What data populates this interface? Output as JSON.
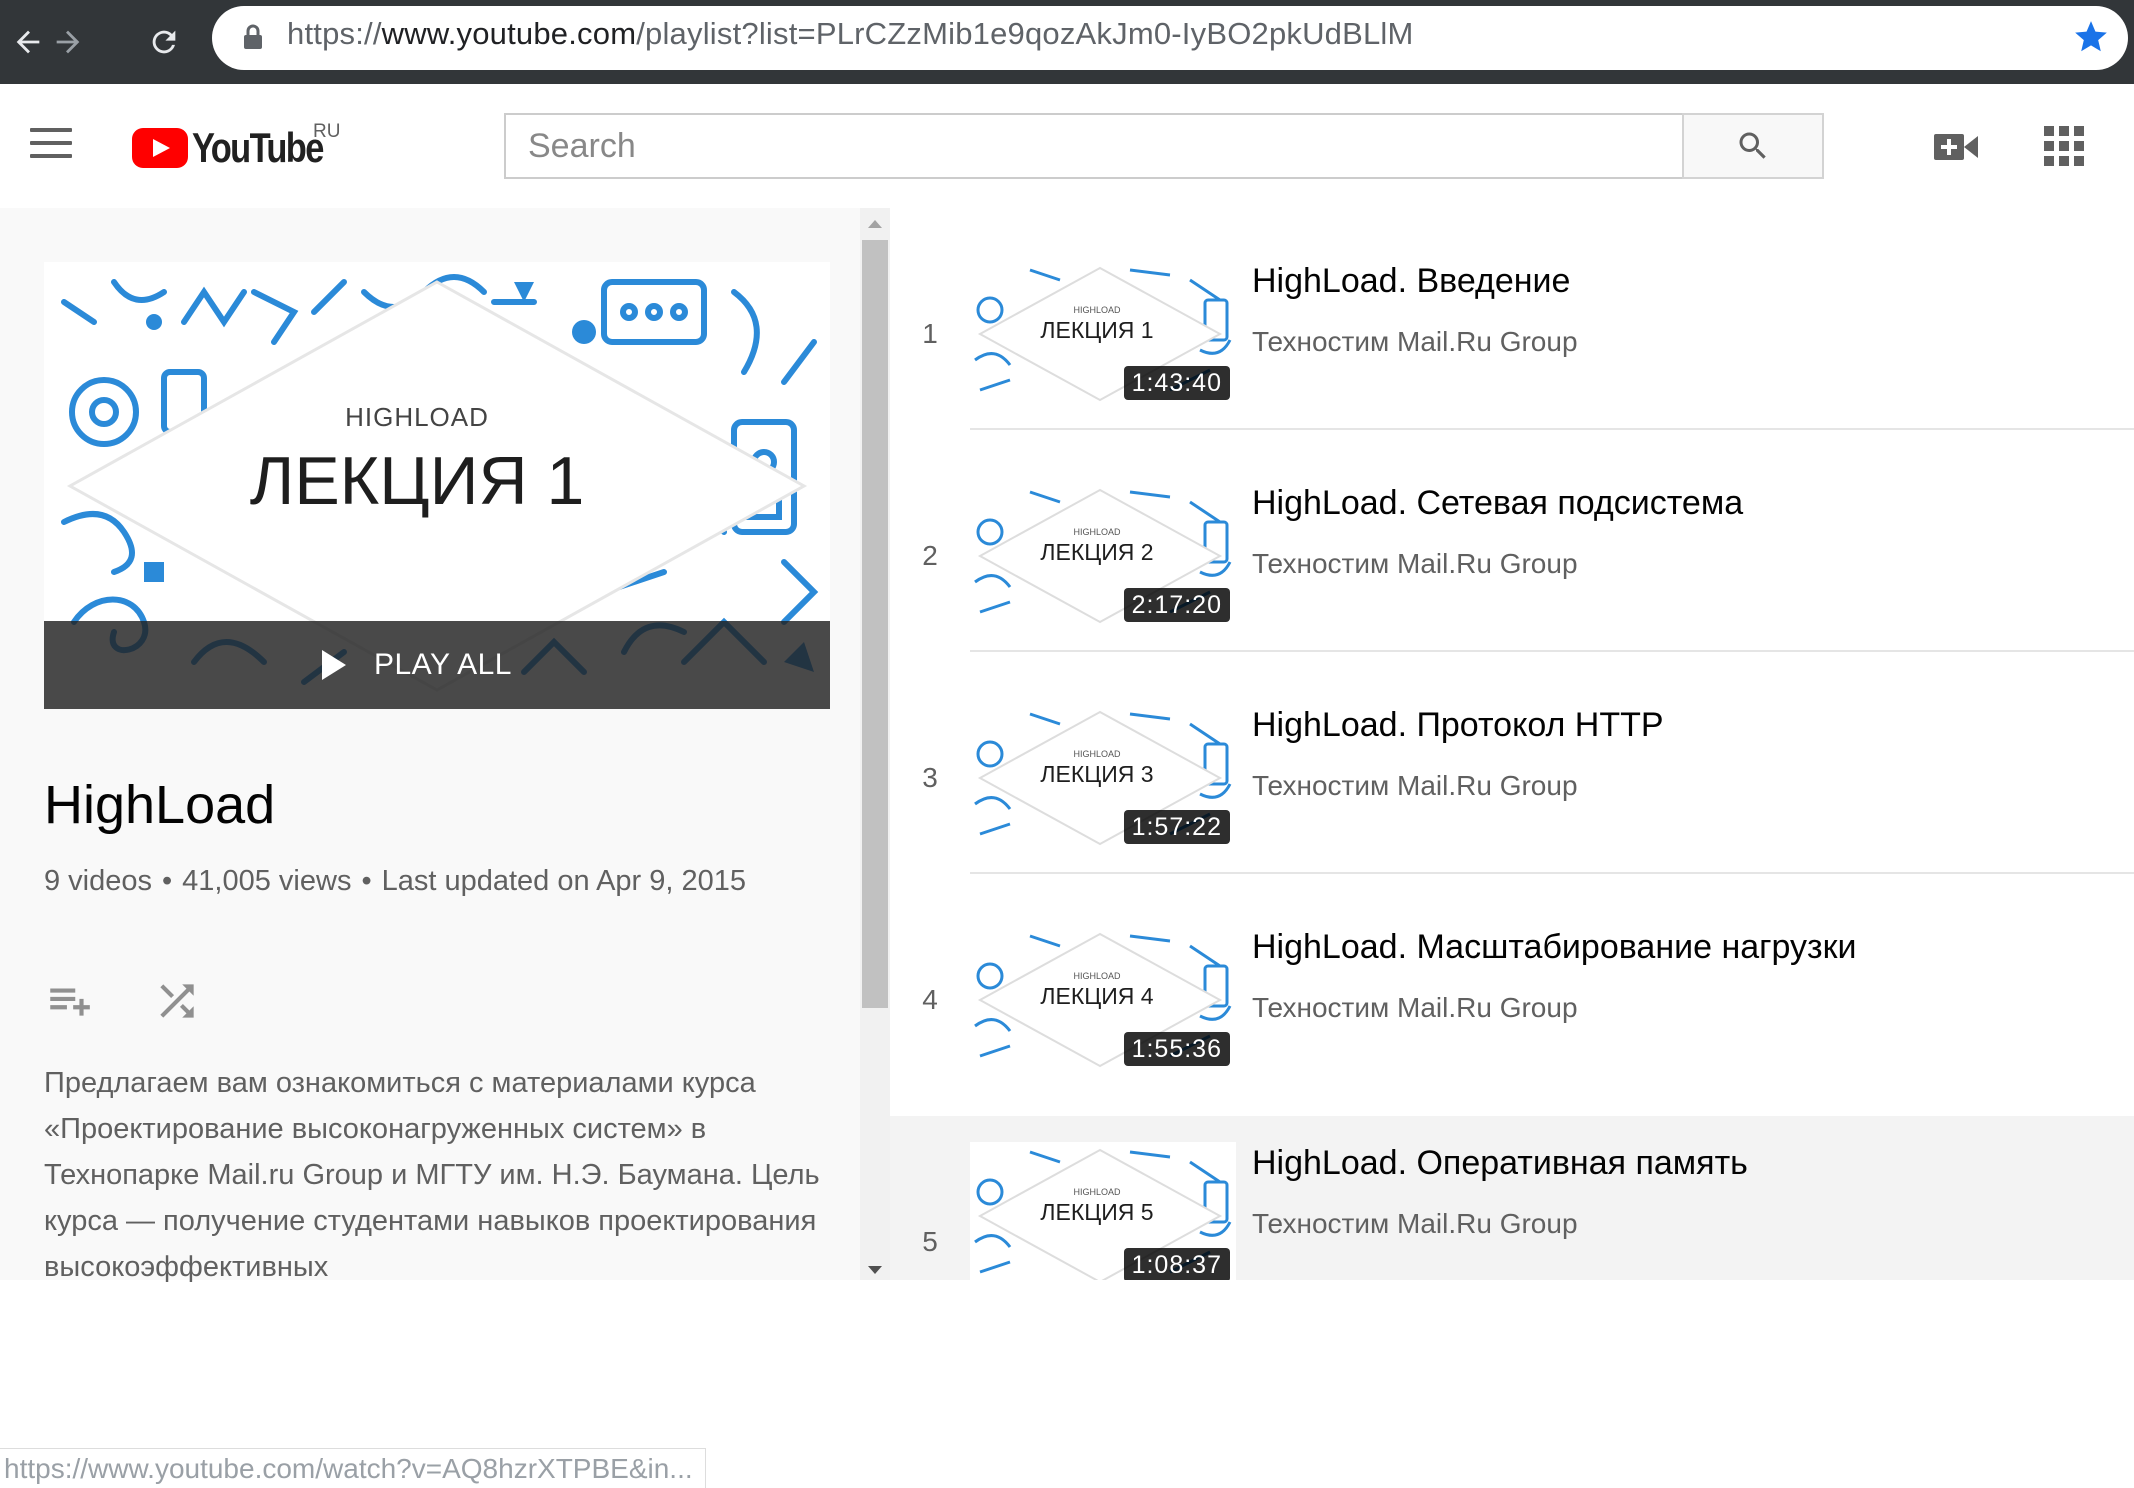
{
  "browser": {
    "url_scheme": "https://",
    "url_host": "www.youtube.com",
    "url_path": "/playlist?list=PLrCZzMib1e9qozAkJm0-IyBO2pkUdBLlM",
    "status_url": "https://www.youtube.com/watch?v=AQ8hzrXTPBE&in..."
  },
  "header": {
    "logo_text": "YouTube",
    "region": "RU",
    "search_placeholder": "Search"
  },
  "playlist": {
    "hero_small": "HIGHLOAD",
    "hero_big": "ЛЕКЦИЯ 1",
    "play_all_label": "PLAY ALL",
    "title": "HighLoad",
    "videos": "9 videos",
    "views": "41,005 views",
    "updated": "Last updated on Apr 9, 2015",
    "separator": "•",
    "description": "Предлагаем вам ознакомиться с материалами курса «Проектирование высоконагруженных систем» в Технопарке Mail.ru Group и МГТУ им. Н.Э. Баумана. Цель курса — получение студентами навыков проектирования высокоэффективных"
  },
  "videos": [
    {
      "index": "1",
      "title": "HighLoad. Введение",
      "channel": "Техностим Mail.Ru Group",
      "duration": "1:43:40",
      "thumb_small": "HIGHLOAD",
      "thumb_big": "ЛЕКЦИЯ 1"
    },
    {
      "index": "2",
      "title": "HighLoad. Сетевая подсистема",
      "channel": "Техностим Mail.Ru Group",
      "duration": "2:17:20",
      "thumb_small": "HIGHLOAD",
      "thumb_big": "ЛЕКЦИЯ 2"
    },
    {
      "index": "3",
      "title": "HighLoad. Протокол HTTP",
      "channel": "Техностим Mail.Ru Group",
      "duration": "1:57:22",
      "thumb_small": "HIGHLOAD",
      "thumb_big": "ЛЕКЦИЯ 3"
    },
    {
      "index": "4",
      "title": "HighLoad. Масштабирование нагрузки",
      "channel": "Техностим Mail.Ru Group",
      "duration": "1:55:36",
      "thumb_small": "HIGHLOAD",
      "thumb_big": "ЛЕКЦИЯ 4"
    },
    {
      "index": "5",
      "title": "HighLoad. Оперативная память",
      "channel": "Техностим Mail.Ru Group",
      "duration": "1:08:37",
      "thumb_small": "HIGHLOAD",
      "thumb_big": "ЛЕКЦИЯ 5"
    }
  ],
  "icons": {
    "back": "arrow-left-icon",
    "forward": "arrow-right-icon",
    "reload": "reload-icon",
    "lock": "lock-icon",
    "bookmark": "star-icon",
    "menu": "hamburger-icon",
    "search": "search-icon",
    "create": "video-camera-plus-icon",
    "apps": "apps-grid-icon",
    "add_to_queue": "playlist-add-icon",
    "shuffle": "shuffle-icon",
    "play": "play-icon"
  },
  "colors": {
    "brand_red": "#ff0000",
    "browser_bar": "#323639",
    "bookmark_star": "#1a73e8",
    "doodle_blue": "#2b8ad8"
  }
}
